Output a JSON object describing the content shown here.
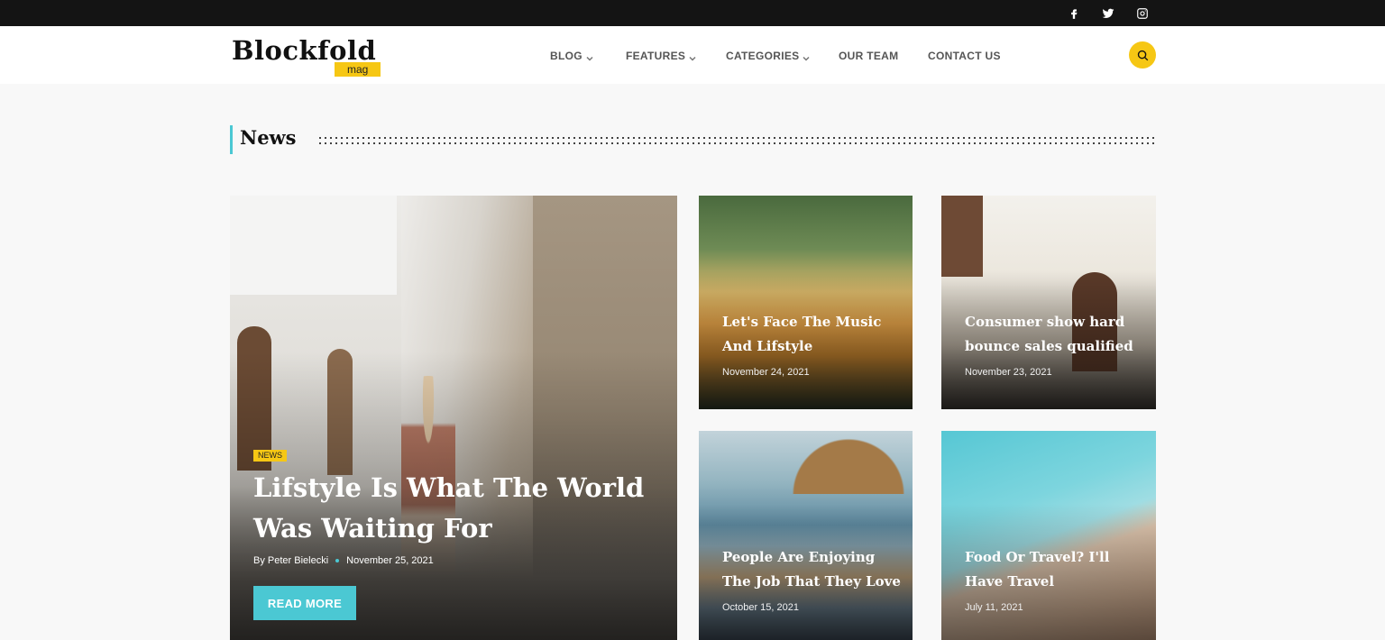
{
  "brand": {
    "name": "Blockfold",
    "sub": "mag"
  },
  "social": [
    "facebook-icon",
    "twitter-icon",
    "instagram-icon"
  ],
  "nav": [
    {
      "label": "BLOG",
      "dropdown": true
    },
    {
      "label": "FEATURES",
      "dropdown": true
    },
    {
      "label": "CATEGORIES",
      "dropdown": true
    },
    {
      "label": "OUR TEAM",
      "dropdown": false
    },
    {
      "label": "CONTACT US",
      "dropdown": false
    }
  ],
  "section": {
    "title": "News"
  },
  "featured": {
    "badge": "NEWS",
    "title": "Lifstyle Is What The World Was Waiting For",
    "author": "By Peter Bielecki",
    "date": "November 25, 2021",
    "cta": "READ MORE"
  },
  "cards": [
    {
      "title": "Let's Face The Music And Lifstyle",
      "date": "November 24, 2021"
    },
    {
      "title": "Consumer show hard bounce sales qualified",
      "date": "November 23, 2021"
    },
    {
      "title": "People Are Enjoying The Job That They Love",
      "date": "October 15, 2021"
    },
    {
      "title": "Food Or Travel? I'll Have Travel",
      "date": "July 11, 2021"
    }
  ],
  "colors": {
    "accent": "#4bc8d3",
    "yellow": "#f6c714",
    "topbar": "#141414"
  }
}
